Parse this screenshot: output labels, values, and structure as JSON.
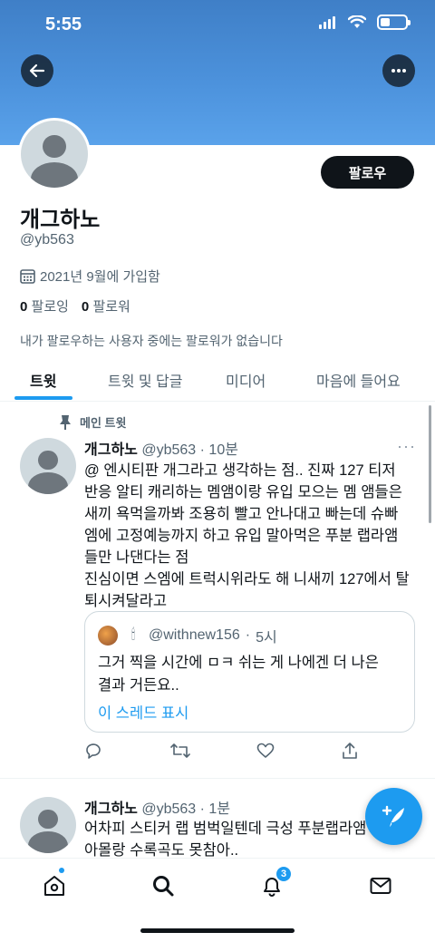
{
  "status_bar": {
    "time": "5:55"
  },
  "profile": {
    "display_name": "개그하노",
    "handle": "@yb563",
    "joined": "2021년 9월에 가입함",
    "following_count": "0",
    "following_label": "팔로잉",
    "followers_count": "0",
    "followers_label": "팔로워",
    "no_followers_note": "내가 팔로우하는 사용자 중에는 팔로워가 없습니다",
    "follow_button": "팔로우"
  },
  "tabs": [
    {
      "label": "트윗",
      "active": true
    },
    {
      "label": "트윗 및 답글",
      "active": false
    },
    {
      "label": "미디어",
      "active": false
    },
    {
      "label": "마음에 들어요",
      "active": false
    }
  ],
  "pinned_label": "메인 트윗",
  "tweets": [
    {
      "name": "개그하노",
      "handle": "@yb563",
      "time": "10분",
      "lines": [
        "@ 엔시티판 개그라고 생각하는 점.. 진짜 127 티저",
        "반응 알티 캐리하는 멤앰이랑 유입 모으는 멤 앰들은",
        "새끼 욕먹을까봐 조용히 빨고 안나대고 빠는데 슈빠",
        "엠에 고정예능까지 하고 유입 말아먹은 푸분 랩라앰",
        "들만 나댄다는 점",
        "진심이면 스엠에 트럭시위라도 해 니새끼 127에서 탈",
        "퇴시켜달라고"
      ],
      "quote": {
        "handle": "@withnew156",
        "time": "5시",
        "lines": [
          "그거 찍을 시간에 ㅁㅋ 쉬는 게 나에겐 더 나은",
          "결과 거든요.."
        ],
        "show_thread": "이 스레드 표시"
      }
    },
    {
      "name": "개그하노",
      "handle": "@yb563",
      "time": "1분",
      "lines": [
        "어차피 스티커 랩 범벅일텐데 극성 푸분랩라앰",
        "아몰랑 수록곡도 못참아.."
      ]
    }
  ],
  "bottom_nav": {
    "notifications_badge": "3"
  },
  "colors": {
    "accent": "#1d9bf0",
    "banner": "#4d93dd",
    "text": "#0f1419",
    "secondary": "#536471"
  }
}
